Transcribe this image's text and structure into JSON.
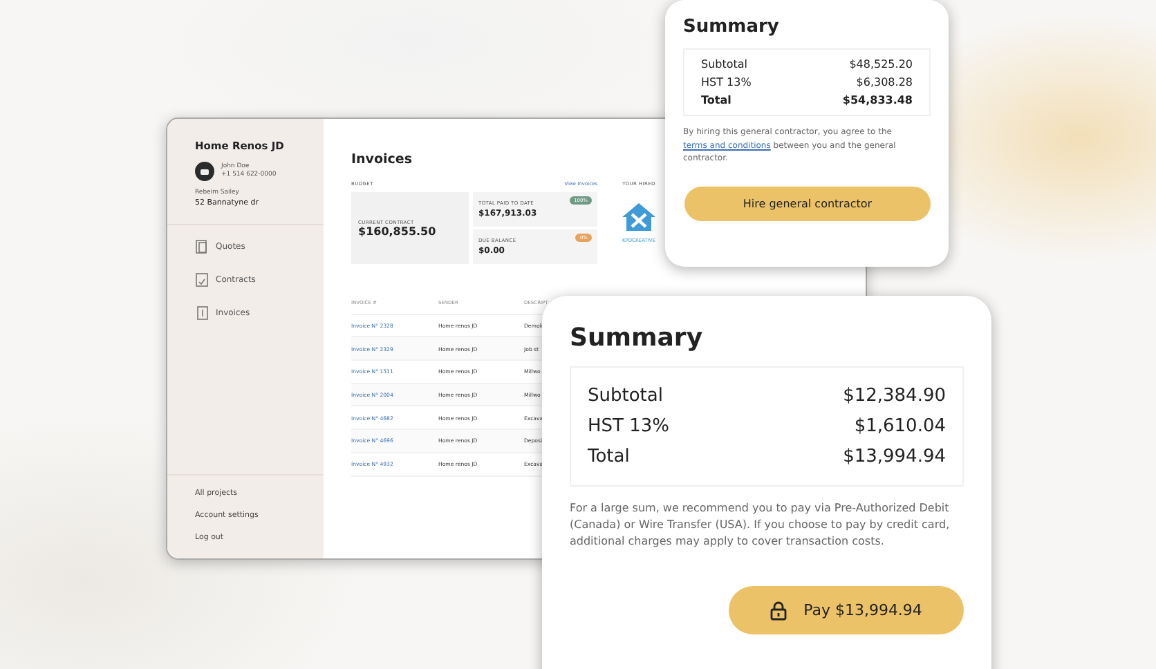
{
  "app": {
    "project": "Home Renos JD",
    "contact": {
      "name": "John Doe",
      "phone": "+1 514 622-0000"
    },
    "client": {
      "name": "Rebeim Sailey",
      "address": "52 Bannatyne dr"
    },
    "nav": [
      {
        "label": "Quotes",
        "kind": "quote"
      },
      {
        "label": "Contracts",
        "kind": "contract"
      },
      {
        "label": "Invoices",
        "kind": "invoice"
      }
    ],
    "footer_links": [
      "All projects",
      "Account settings",
      "Log out"
    ],
    "page_title": "Invoices",
    "budget": {
      "label": "BUDGET",
      "link": "View Invoices",
      "current": {
        "label": "CURRENT CONTRACT",
        "value": "$160,855.50"
      },
      "stats": [
        {
          "label": "TOTAL PAID TO DATE",
          "value": "$167,913.03",
          "badge": "100%",
          "color": "#6f9b86"
        },
        {
          "label": "DUE BALANCE",
          "value": "$0.00",
          "badge": "0%",
          "color": "#e8a25c"
        }
      ]
    },
    "hired": {
      "label": "YOUR HIRED",
      "logo_text": "KPDCREATIVE"
    },
    "table": {
      "columns": [
        "INVOICE #",
        "SENDER",
        "DESCRIPT"
      ],
      "rows": [
        [
          "Invoice N° 2328",
          "Home renos JD",
          "Demoli"
        ],
        [
          "Invoice N° 2329",
          "Home renos JD",
          "Job st"
        ],
        [
          "Invoice N° 1511",
          "Home renos JD",
          "Millwo"
        ],
        [
          "Invoice N° 2004",
          "Home renos JD",
          "Millwo"
        ],
        [
          "Invoice N° 4682",
          "Home renos JD",
          "Excava"
        ],
        [
          "Invoice N° 4696",
          "Home renos JD",
          "Deposi"
        ],
        [
          "Invoice N° 4932",
          "Home renos JD",
          "Excava"
        ]
      ]
    }
  },
  "summary_cards": [
    {
      "kind": "hire",
      "title": "Summary",
      "lines": [
        {
          "label": "Subtotal",
          "value": "$48,525.20",
          "bold": false
        },
        {
          "label": "HST 13%",
          "value": "$6,308.28",
          "bold": false
        },
        {
          "label": "Total",
          "value": "$54,833.48",
          "bold": true
        }
      ],
      "note": {
        "before": "By hiring this general contractor, you agree to the ",
        "link": "terms and conditions",
        "after": " between you and the general contractor."
      },
      "button": {
        "label": "Hire general contractor"
      }
    },
    {
      "kind": "pay",
      "title": "Summary",
      "lines": [
        {
          "label": "Subtotal",
          "value": "$12,384.90",
          "bold": false
        },
        {
          "label": "HST 13%",
          "value": "$1,610.04",
          "bold": false
        },
        {
          "label": "Total",
          "value": "$13,994.94",
          "bold": false
        }
      ],
      "note": {
        "before": "For a large sum, we recommend you to pay via Pre-Authorized Debit (Canada) or Wire Transfer (USA). If you choose to pay by credit card, additional charges may apply to cover transaction costs."
      },
      "button": {
        "label": "Pay $13,994.94"
      }
    }
  ]
}
